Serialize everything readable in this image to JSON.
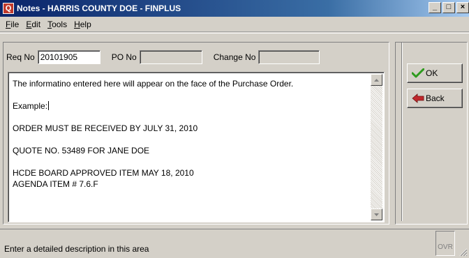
{
  "window": {
    "icon": "finplus-app-icon",
    "icon_glyph": "Q",
    "title": "Notes - HARRIS COUNTY DOE - FINPLUS",
    "minimize": "_",
    "maximize": "□",
    "close": "×"
  },
  "menu": [
    "File",
    "Edit",
    "Tools",
    "Help"
  ],
  "fields": {
    "req_label": "Req No",
    "req_value": "20101905",
    "po_label": "PO No",
    "po_value": "",
    "change_label": "Change No",
    "change_value": ""
  },
  "notes": [
    "The informatino entered here will appear on the face of the Purchase Order.",
    "Example:",
    "ORDER MUST BE RECEIVED BY JULY 31, 2010",
    "QUOTE NO. 53489 FOR JANE DOE",
    "HCDE BOARD APPROVED ITEM MAY 18, 2010",
    "AGENDA ITEM # 7.6.F"
  ],
  "buttons": {
    "ok": "OK",
    "ok_icon": "green-checkmark-icon",
    "back": "Back",
    "back_icon": "red-back-arrow-icon"
  },
  "status": {
    "message": "Enter a detailed description in this area",
    "mode": "OVR"
  },
  "colors": {
    "titlebar_start": "#0a246a",
    "titlebar_end": "#a6caf0",
    "window_face": "#d4d0c8",
    "ok_check": "#2e9b1e",
    "back_arrow": "#c0282c"
  }
}
